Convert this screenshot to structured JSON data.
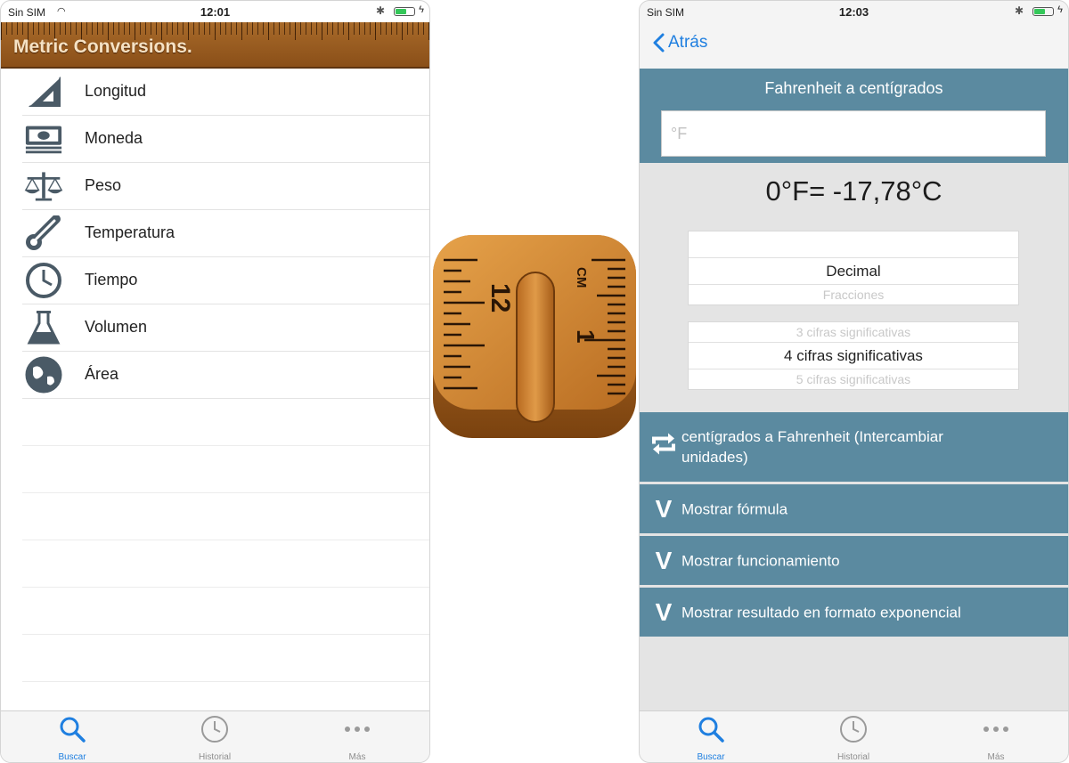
{
  "left_screen": {
    "status": {
      "carrier": "Sin SIM",
      "time": "12:01"
    },
    "header_title": "Metric Conversions.",
    "categories": [
      {
        "label": "Longitud",
        "icon": "ruler-triangle-icon"
      },
      {
        "label": "Moneda",
        "icon": "money-icon"
      },
      {
        "label": "Peso",
        "icon": "scale-icon"
      },
      {
        "label": "Temperatura",
        "icon": "thermometer-icon"
      },
      {
        "label": "Tiempo",
        "icon": "clock-icon"
      },
      {
        "label": "Volumen",
        "icon": "flask-icon"
      },
      {
        "label": "Área",
        "icon": "globe-icon"
      }
    ],
    "tabs": [
      {
        "label": "Buscar",
        "icon": "search-icon",
        "active": true
      },
      {
        "label": "Historial",
        "icon": "history-clock-icon",
        "active": false
      },
      {
        "label": "Más",
        "icon": "more-dots-icon",
        "active": false
      }
    ]
  },
  "right_screen": {
    "status": {
      "carrier": "Sin SIM",
      "time": "12:03"
    },
    "back_label": "Atrás",
    "conversion_title": "Fahrenheit a centígrados",
    "input_placeholder": "°F",
    "result": "0°F= -17,78°C",
    "format_picker": [
      "",
      "Decimal",
      "Fracciones"
    ],
    "precision_picker": [
      "3 cifras significativas",
      "4 cifras significativas",
      "5 cifras significativas"
    ],
    "swap_label": "centígrados a Fahrenheit (Intercambiar unidades)",
    "actions": [
      {
        "label": "Mostrar fórmula"
      },
      {
        "label": "Mostrar funcionamiento"
      },
      {
        "label": "Mostrar resultado en formato exponencial"
      }
    ],
    "tabs": [
      {
        "label": "Buscar",
        "icon": "search-icon",
        "active": true
      },
      {
        "label": "Historial",
        "icon": "history-clock-icon",
        "active": false
      },
      {
        "label": "Más",
        "icon": "more-dots-icon",
        "active": false
      }
    ]
  },
  "app_icon": {
    "numbers": [
      "12",
      "1"
    ],
    "unit": "CM"
  },
  "colors": {
    "accent": "#1f7fe0",
    "panel": "#5b8aa0",
    "wood": "#a86a2a",
    "icon_gray": "#4a5a66"
  }
}
